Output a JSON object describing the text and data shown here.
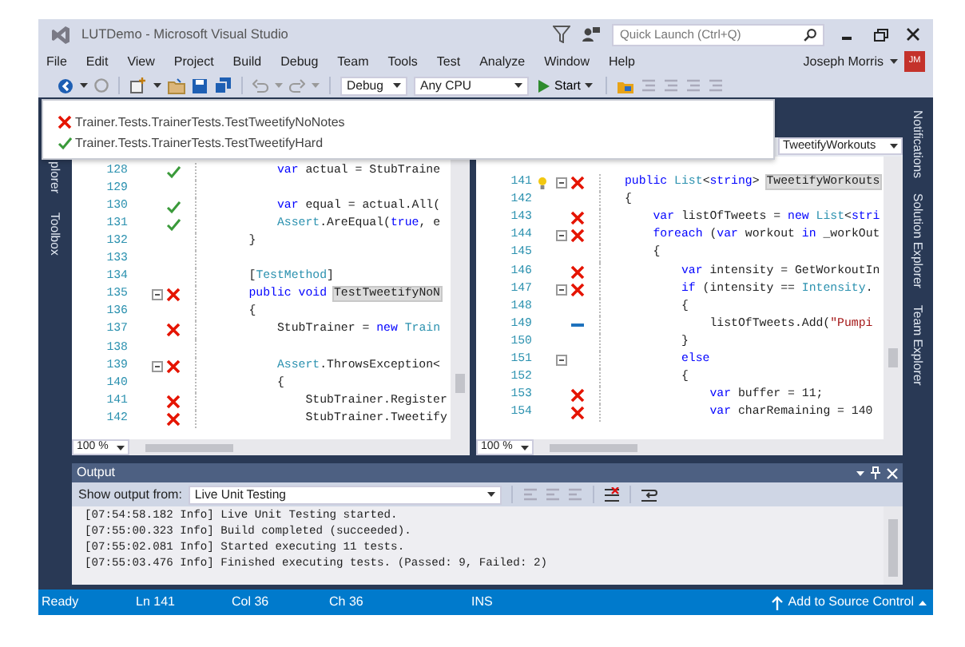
{
  "window": {
    "title": "LUTDemo - Microsoft Visual Studio"
  },
  "quick_launch": {
    "placeholder": "Quick Launch (Ctrl+Q)"
  },
  "menu": [
    "File",
    "Edit",
    "View",
    "Project",
    "Build",
    "Debug",
    "Team",
    "Tools",
    "Test",
    "Analyze",
    "Window",
    "Help"
  ],
  "account": {
    "name": "Joseph Morris",
    "initials": "JM"
  },
  "toolbar": {
    "configuration": "Debug",
    "platform": "Any CPU",
    "start": "Start"
  },
  "left_tool_tabs": [
    "plorer",
    "Toolbox"
  ],
  "right_tool_tabs": [
    "Notifications",
    "Solution Explorer",
    "Team Explorer"
  ],
  "test_popup": {
    "tests": [
      {
        "name": "Trainer.Tests.TrainerTests.TestTweetifyNoNotes",
        "kind": "failed"
      },
      {
        "name": "Trainer.Tests.TrainerTests.TestTweetifyHard",
        "kind": "passed"
      }
    ]
  },
  "editors": [
    {
      "zoom": "100 %",
      "lines": [
        {
          "number": "128",
          "kind": "passed",
          "tokens": [
            {
              "kind": "keyword",
              "text": "        var"
            },
            {
              "kind": "plain",
              "text": " actual = StubTraine"
            }
          ]
        },
        {
          "number": "129"
        },
        {
          "number": "130",
          "kind": "passed",
          "tokens": [
            {
              "kind": "keyword",
              "text": "        var"
            },
            {
              "kind": "plain",
              "text": " equal = actual.All("
            }
          ]
        },
        {
          "number": "131",
          "kind": "passed",
          "tokens": [
            {
              "kind": "type",
              "text": "        Assert"
            },
            {
              "kind": "plain",
              "text": ".AreEqual("
            },
            {
              "kind": "keyword",
              "text": "true"
            },
            {
              "kind": "plain",
              "text": ", e"
            }
          ]
        },
        {
          "number": "132",
          "tokens": [
            {
              "kind": "plain",
              "text": "    }"
            }
          ]
        },
        {
          "number": "133"
        },
        {
          "number": "134",
          "tokens": [
            {
              "kind": "plain",
              "text": "    ["
            },
            {
              "kind": "type",
              "text": "TestMethod"
            },
            {
              "kind": "plain",
              "text": "]"
            }
          ]
        },
        {
          "number": "135",
          "kind": "failed",
          "fold": true,
          "tokens": [
            {
              "kind": "keyword",
              "text": "    public void "
            },
            {
              "kind": "highlight",
              "text": "TestTweetifyNoN"
            }
          ]
        },
        {
          "number": "136",
          "tokens": [
            {
              "kind": "plain",
              "text": "    {"
            }
          ]
        },
        {
          "number": "137",
          "kind": "failed",
          "tokens": [
            {
              "kind": "plain",
              "text": "        StubTrainer = "
            },
            {
              "kind": "keyword",
              "text": "new "
            },
            {
              "kind": "type",
              "text": "Train"
            }
          ]
        },
        {
          "number": "138"
        },
        {
          "number": "139",
          "kind": "failed",
          "fold": true,
          "tokens": [
            {
              "kind": "type",
              "text": "        Assert"
            },
            {
              "kind": "plain",
              "text": ".ThrowsException<"
            }
          ]
        },
        {
          "number": "140",
          "tokens": [
            {
              "kind": "plain",
              "text": "        {"
            }
          ]
        },
        {
          "number": "141",
          "kind": "failed",
          "tokens": [
            {
              "kind": "plain",
              "text": "            StubTrainer.Register"
            }
          ]
        },
        {
          "number": "142",
          "kind": "failed",
          "tokens": [
            {
              "kind": "plain",
              "text": "            StubTrainer.Tweetify"
            }
          ]
        }
      ]
    },
    {
      "nav": "TweetifyWorkouts",
      "zoom": "100 %",
      "lines": [
        {
          "number": "141",
          "kind": "failed",
          "fold": true,
          "bulb": true,
          "tokens": [
            {
              "kind": "keyword",
              "text": "public"
            },
            {
              "kind": "type",
              "text": " List"
            },
            {
              "kind": "plain",
              "text": "<"
            },
            {
              "kind": "keyword",
              "text": "string"
            },
            {
              "kind": "plain",
              "text": "> "
            },
            {
              "kind": "highlight",
              "text": "TweetifyWorkouts"
            }
          ]
        },
        {
          "number": "142",
          "tokens": [
            {
              "kind": "plain",
              "text": "{"
            }
          ]
        },
        {
          "number": "143",
          "kind": "failed",
          "tokens": [
            {
              "kind": "keyword",
              "text": "    var"
            },
            {
              "kind": "plain",
              "text": " listOfTweets = "
            },
            {
              "kind": "keyword",
              "text": "new"
            },
            {
              "kind": "type",
              "text": " List"
            },
            {
              "kind": "plain",
              "text": "<"
            },
            {
              "kind": "keyword",
              "text": "stri"
            }
          ]
        },
        {
          "number": "144",
          "kind": "failed",
          "fold": true,
          "tokens": [
            {
              "kind": "keyword",
              "text": "    foreach"
            },
            {
              "kind": "plain",
              "text": " ("
            },
            {
              "kind": "keyword",
              "text": "var"
            },
            {
              "kind": "plain",
              "text": " workout "
            },
            {
              "kind": "keyword",
              "text": "in"
            },
            {
              "kind": "plain",
              "text": " _workOut"
            }
          ]
        },
        {
          "number": "145",
          "tokens": [
            {
              "kind": "plain",
              "text": "    {"
            }
          ]
        },
        {
          "number": "146",
          "kind": "failed",
          "tokens": [
            {
              "kind": "keyword",
              "text": "        var"
            },
            {
              "kind": "plain",
              "text": " intensity = GetWorkoutIn"
            }
          ]
        },
        {
          "number": "147",
          "kind": "failed",
          "fold": true,
          "tokens": [
            {
              "kind": "keyword",
              "text": "        if"
            },
            {
              "kind": "plain",
              "text": " (intensity == "
            },
            {
              "kind": "type",
              "text": "Intensity"
            },
            {
              "kind": "plain",
              "text": "."
            }
          ]
        },
        {
          "number": "148",
          "tokens": [
            {
              "kind": "plain",
              "text": "        {"
            }
          ]
        },
        {
          "number": "149",
          "kind": "uncovered",
          "tokens": [
            {
              "kind": "plain",
              "text": "            listOfTweets.Add("
            },
            {
              "kind": "string",
              "text": "\"Pumpi"
            }
          ]
        },
        {
          "number": "150",
          "tokens": [
            {
              "kind": "plain",
              "text": "        }"
            }
          ]
        },
        {
          "number": "151",
          "fold": true,
          "tokens": [
            {
              "kind": "keyword",
              "text": "        else"
            }
          ]
        },
        {
          "number": "152",
          "tokens": [
            {
              "kind": "plain",
              "text": "        {"
            }
          ]
        },
        {
          "number": "153",
          "kind": "failed",
          "tokens": [
            {
              "kind": "keyword",
              "text": "            var"
            },
            {
              "kind": "plain",
              "text": " buffer = 11;"
            }
          ]
        },
        {
          "number": "154",
          "kind": "failed",
          "tokens": [
            {
              "kind": "keyword",
              "text": "            var"
            },
            {
              "kind": "plain",
              "text": " charRemaining = 140"
            }
          ]
        }
      ]
    }
  ],
  "output": {
    "title": "Output",
    "source_label": "Show output from:",
    "source": "Live Unit Testing",
    "lines": [
      "[07:54:58.182 Info] Live Unit Testing started.",
      "[07:55:00.323 Info] Build completed (succeeded).",
      "[07:55:02.081 Info] Started executing 11 tests.",
      "[07:55:03.476 Info] Finished executing tests. (Passed: 9, Failed: 2)"
    ]
  },
  "status_bar": {
    "items": [
      "Ready",
      "Ln 141",
      "Col 36",
      "Ch 36",
      "INS"
    ],
    "source_control": "Add to Source Control"
  }
}
